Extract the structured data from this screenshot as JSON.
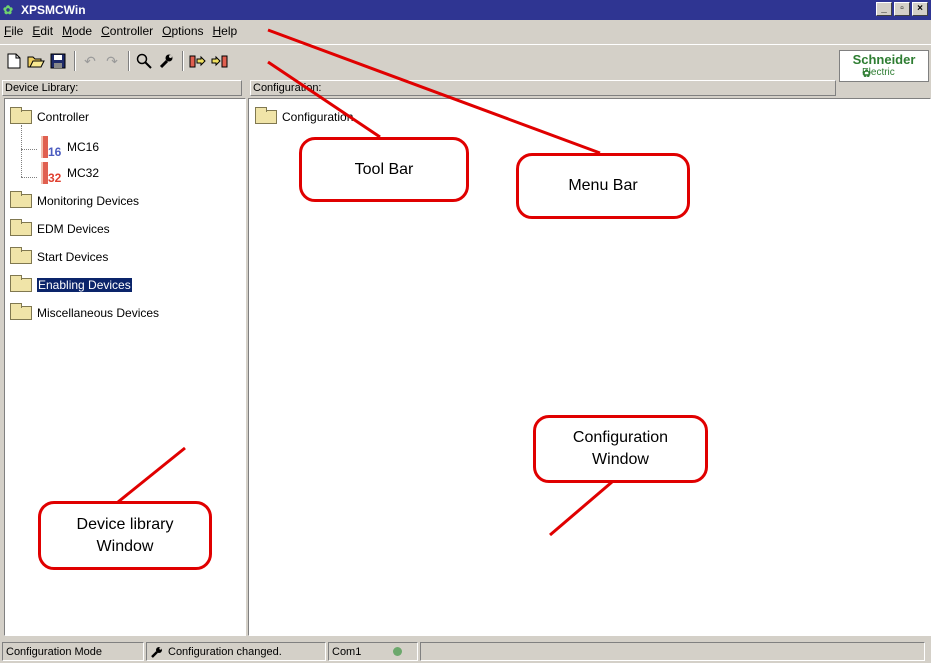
{
  "window": {
    "title": "XPSMCWin",
    "app_icon": "xp-app-icon",
    "min": "_",
    "max": "▫",
    "close": "×"
  },
  "menu": [
    "File",
    "Edit",
    "Mode",
    "Controller",
    "Options",
    "Help"
  ],
  "toolbar": {
    "new": "🗋",
    "open": "📂",
    "save": "💾",
    "undo": "↶",
    "redo": "↷",
    "find": "🔍",
    "config": "🔧",
    "upload": "⇨",
    "download": "⇦"
  },
  "brand": {
    "name": "Schneider",
    "sub": "Electric"
  },
  "library": {
    "header": "Device Library:",
    "items": [
      {
        "label": "Controller",
        "type": "folder"
      },
      {
        "label": "MC16",
        "type": "device",
        "num": "16",
        "num_color": "#4a5bc0"
      },
      {
        "label": "MC32",
        "type": "device",
        "num": "32",
        "num_color": "#e04030"
      },
      {
        "label": "Monitoring Devices",
        "type": "folder"
      },
      {
        "label": "EDM Devices",
        "type": "folder"
      },
      {
        "label": "Start Devices",
        "type": "folder"
      },
      {
        "label": "Enabling Devices",
        "type": "folder",
        "selected": true
      },
      {
        "label": "Miscellaneous Devices",
        "type": "folder"
      }
    ]
  },
  "configuration": {
    "header": "Configuration:",
    "root": "Configuration"
  },
  "status": {
    "mode": "Configuration Mode",
    "message": "Configuration changed.",
    "port": "Com1",
    "led_color": "#6ca86c"
  },
  "callouts": {
    "toolbar": "Tool Bar",
    "menubar": "Menu Bar",
    "config_window_1": "Configuration",
    "config_window_2": "Window",
    "library_window_1": "Device library",
    "library_window_2": "Window"
  },
  "colors": {
    "titlebar": "#2f3592",
    "callout": "#e00000",
    "selection": "#0a246a"
  }
}
